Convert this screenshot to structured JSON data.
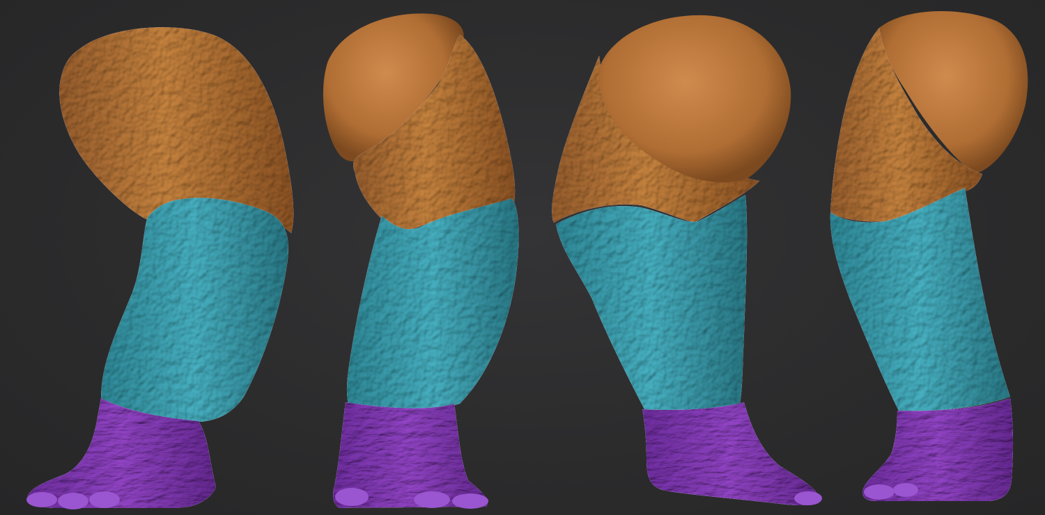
{
  "scene": {
    "background_color": "#2c2c2d",
    "materials": {
      "thigh": "#b8773f",
      "shin": "#3fa8b8",
      "foot": "#8a3fc0"
    },
    "views": [
      {
        "id": "view-1",
        "label": ""
      },
      {
        "id": "view-2",
        "label": ""
      },
      {
        "id": "view-3",
        "label": ""
      },
      {
        "id": "view-4",
        "label": ""
      }
    ]
  }
}
